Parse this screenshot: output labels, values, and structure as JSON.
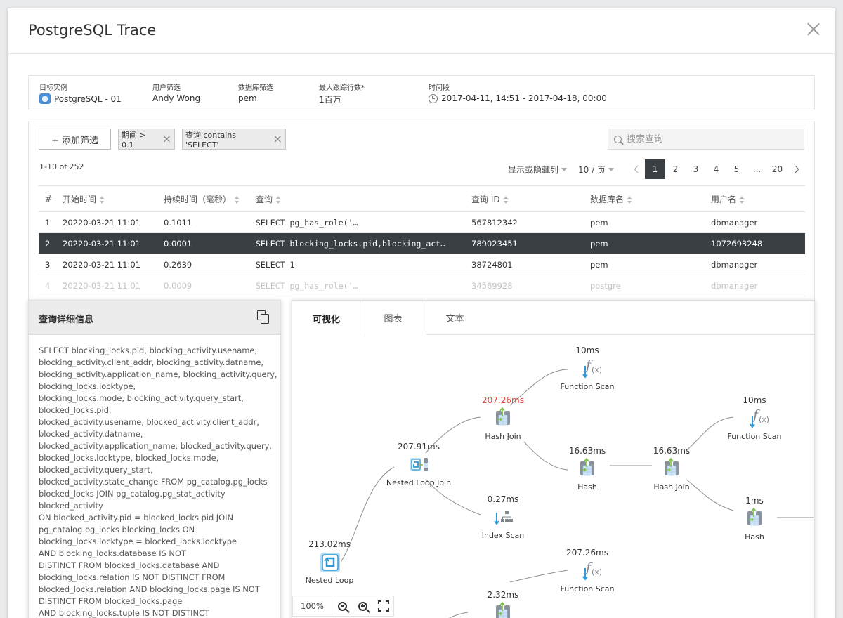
{
  "modal": {
    "title": "PostgreSQL Trace"
  },
  "info": {
    "instance_label": "目标实例",
    "instance_value": "PostgreSQL - 01",
    "user_label": "用户筛选",
    "user_value": "Andy Wong",
    "db_label": "数据库筛选",
    "db_value": "pem",
    "max_rows_label": "最大跟踪行数*",
    "max_rows_value": "1百万",
    "time_label": "时间段",
    "time_value": "2017-04-11, 14:51 - 2017-04-18, 00:00"
  },
  "filters": {
    "add_label": "+ 添加筛选",
    "chips": [
      "期间 > 0.1",
      "查询 contains 'SELECT'"
    ],
    "search_placeholder": "搜索查询"
  },
  "table": {
    "count_text": "1-10 of 252",
    "columns_toggle": "显示或隐藏列",
    "page_size": "10 / 页",
    "pages": [
      "1",
      "2",
      "3",
      "4",
      "5",
      "...",
      "20"
    ],
    "current_page": "1",
    "headers": [
      "#",
      "开始时间",
      "持续时间（毫秒）",
      "查询",
      "查询 ID",
      "数据库名",
      "用户名"
    ],
    "rows": [
      {
        "num": "1",
        "start": "20220-03-21 11:01",
        "duration": "0.1011",
        "query": "SELECT pg_has_role('…",
        "qid": "567812342",
        "db": "pem",
        "user": "dbmanager"
      },
      {
        "num": "2",
        "start": "20220-03-21 11:01",
        "duration": "0.0001",
        "query": "SELECT blocking_locks.pid,blocking_act…",
        "qid": "789023451",
        "db": "pem",
        "user": "1072693248"
      },
      {
        "num": "3",
        "start": "20220-03-21 11:01",
        "duration": "0.2639",
        "query": "SELECT 1",
        "qid": "38724801",
        "db": "pem",
        "user": "dbmanager"
      },
      {
        "num": "4",
        "start": "20220-03-21 11:01",
        "duration": "0.0009",
        "query": "SELECT pg_has_role('…",
        "qid": "34569928",
        "db": "postgre",
        "user": "dbmanager"
      }
    ]
  },
  "detail": {
    "title": "查询详细信息",
    "sql_lines": [
      "SELECT blocking_locks.pid, blocking_activity.usename,",
      "blocking_activity.client_addr, blocking_activity.datname,",
      "blocking_activity.application_name, blocking_activity.query,",
      "blocking_locks.locktype,",
      "blocking_locks.mode, blocking_activity.query_start,",
      "blocked_locks.pid,",
      "blocked_activity.usename, blocked_activity.client_addr,",
      "blocked_activity.datname,",
      "blocked_activity.application_name, blocked_activity.query,",
      "blocked_locks.locktype, blocked_locks.mode,",
      "blocked_activity.query_start,",
      "blocked_activity.state_change FROM pg_catalog.pg_locks",
      "blocked_locks JOIN pg_catalog.pg_stat_activity",
      "blocked_activity",
      "ON blocked_activity.pid = blocked_locks.pid JOIN",
      "pg_catalog.pg_locks blocking_locks ON",
      "blocking_locks.locktype = blocked_locks.locktype",
      "AND blocking_locks.database IS NOT",
      "DISTINCT FROM blocked_locks.database AND",
      "blocking_locks.relation IS NOT DISTINCT FROM",
      "blocked_locks.relation AND blocking_locks.page IS NOT",
      "DISTINCT FROM blocked_locks.page",
      "AND blocking_locks.tuple IS NOT DISTINCT"
    ]
  },
  "viz": {
    "tabs": [
      "可视化",
      "图表",
      "文本"
    ],
    "zoom": "100%",
    "nodes": [
      {
        "id": "nested-loop",
        "label": "Nested Loop",
        "time": "213.02ms",
        "icon": "loop-icon"
      },
      {
        "id": "nested-loop-join",
        "label": "Nested Loop Join",
        "time": "207.91ms",
        "icon": "nested-loop-join-icon"
      },
      {
        "id": "hash-join-1",
        "label": "Hash Join",
        "time": "207.26ms",
        "icon": "hash-join-icon",
        "hot": true
      },
      {
        "id": "function-scan-1",
        "label": "Function Scan",
        "time": "10ms",
        "icon": "function-icon"
      },
      {
        "id": "hash-1",
        "label": "Hash",
        "time": "16.63ms",
        "icon": "hash-icon"
      },
      {
        "id": "hash-join-2",
        "label": "Hash Join",
        "time": "16.63ms",
        "icon": "hash-join-icon"
      },
      {
        "id": "function-scan-2",
        "label": "Function Scan",
        "time": "10ms",
        "icon": "function-icon"
      },
      {
        "id": "hash-2",
        "label": "Hash",
        "time": "1ms",
        "icon": "hash-icon"
      },
      {
        "id": "index-scan",
        "label": "Index Scan",
        "time": "0.27ms",
        "icon": "index-scan-icon"
      },
      {
        "id": "function-scan-3",
        "label": "Function Scan",
        "time": "207.26ms",
        "icon": "function-icon"
      },
      {
        "id": "bottom-node",
        "label": "",
        "time": "2.32ms",
        "icon": "hash-join-icon"
      }
    ],
    "colors": {
      "hot": "#e0473a",
      "accent_blue": "#2f9ad8",
      "accent_green": "#7bc043",
      "icon_grey": "#7d8590"
    }
  }
}
